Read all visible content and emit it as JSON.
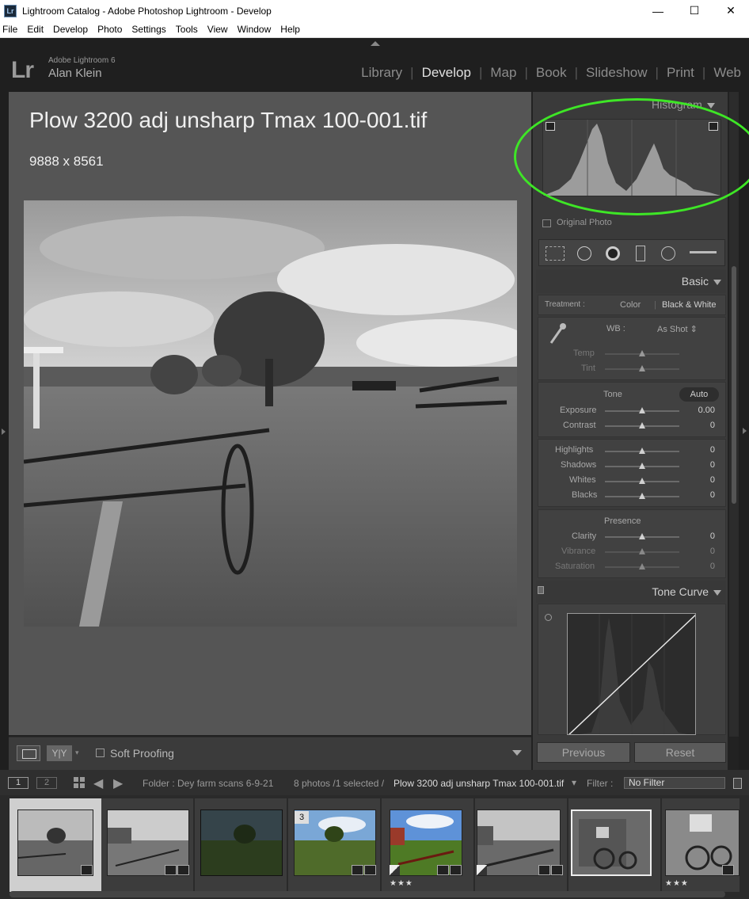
{
  "window": {
    "title": "Lightroom Catalog - Adobe Photoshop Lightroom - Develop",
    "icon_label": "Lr"
  },
  "menu": [
    "File",
    "Edit",
    "Develop",
    "Photo",
    "Settings",
    "Tools",
    "View",
    "Window",
    "Help"
  ],
  "header": {
    "logo": "Lr",
    "product": "Adobe Lightroom 6",
    "user": "Alan Klein",
    "modules": [
      "Library",
      "Develop",
      "Map",
      "Book",
      "Slideshow",
      "Print",
      "Web"
    ],
    "active_module": "Develop"
  },
  "photo_info": {
    "filename": "Plow 3200 adj unsharp Tmax 100-001.tif",
    "dimensions": "9888 x 8561"
  },
  "toolbar": {
    "view_label": "Y|Y",
    "soft_proofing": "Soft Proofing"
  },
  "panels": {
    "histogram": {
      "title": "Histogram",
      "original_photo": "Original Photo"
    },
    "basic": {
      "title": "Basic",
      "treatment_label": "Treatment :",
      "treatment_color": "Color",
      "treatment_bw": "Black & White",
      "wb_label": "WB :",
      "wb_value": "As Shot ⇕",
      "temp_label": "Temp",
      "tint_label": "Tint",
      "tone_label": "Tone",
      "auto_label": "Auto",
      "exposure_label": "Exposure",
      "exposure_value": "0.00",
      "contrast_label": "Contrast",
      "contrast_value": "0",
      "highlights_label": "Highlights",
      "highlights_value": "0",
      "shadows_label": "Shadows",
      "shadows_value": "0",
      "whites_label": "Whites",
      "whites_value": "0",
      "blacks_label": "Blacks",
      "blacks_value": "0",
      "presence_label": "Presence",
      "clarity_label": "Clarity",
      "clarity_value": "0",
      "vibrance_label": "Vibrance",
      "vibrance_value": "0",
      "saturation_label": "Saturation",
      "saturation_value": "0"
    },
    "tone_curve": {
      "title": "Tone Curve"
    },
    "previous_label": "Previous",
    "reset_label": "Reset"
  },
  "filmstrip_bar": {
    "screen1": "1",
    "screen2": "2",
    "folder": "Folder : Dey farm scans 6-9-21",
    "count": "8 photos /1 selected /",
    "selected_file": "Plow 3200 adj unsharp Tmax 100-001.tif",
    "file_caret": "▾",
    "filter_label": "Filter :",
    "filter_value": "No Filter"
  },
  "filmstrip": {
    "thumbs": [
      {
        "stars": "",
        "badge_number": ""
      },
      {
        "stars": "",
        "badge_number": ""
      },
      {
        "stars": "",
        "badge_number": ""
      },
      {
        "stars": "",
        "badge_number": "3"
      },
      {
        "stars": "★★★",
        "badge_number": ""
      },
      {
        "stars": "",
        "badge_number": ""
      },
      {
        "stars": "",
        "badge_number": ""
      },
      {
        "stars": "★★★",
        "badge_number": ""
      }
    ]
  },
  "colors": {
    "highlight_ring": "#3ee626",
    "bg_dark": "#1f1f1f",
    "panel": "#3a3a3a"
  }
}
